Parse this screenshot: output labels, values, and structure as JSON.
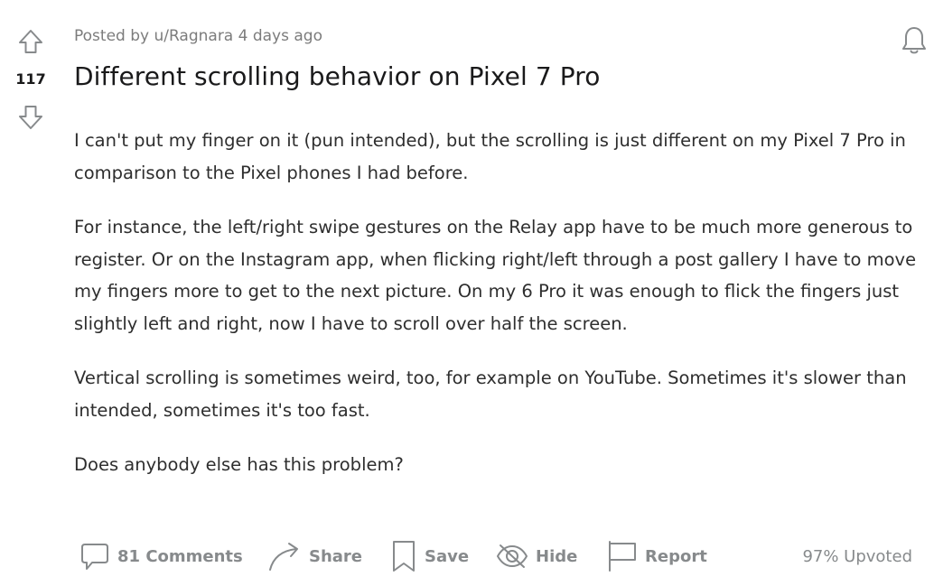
{
  "post": {
    "score": "117",
    "meta": "Posted by u/Ragnara 4 days ago",
    "title": "Different scrolling behavior on Pixel 7 Pro",
    "paragraphs": [
      "I can't put my finger on it (pun intended), but the scrolling is just different on my Pixel 7 Pro in comparison to the Pixel phones I had before.",
      "For instance, the left/right swipe gestures on the Relay app have to be much more generous to register. Or on the Instagram app, when flicking right/left through a post gallery I have to move my fingers more to get to the next picture. On my 6 Pro it was enough to flick the fingers just slightly left and right, now I have to scroll over half the screen.",
      "Vertical scrolling is sometimes weird, too, for example on YouTube. Sometimes it's slower than intended, sometimes it's too fast.",
      "Does anybody else has this problem?"
    ]
  },
  "actions": {
    "comments_label": "81 Comments",
    "share_label": "Share",
    "save_label": "Save",
    "hide_label": "Hide",
    "report_label": "Report",
    "upvoted_text": "97% Upvoted"
  },
  "icons": {
    "upvote": "upvote-arrow-icon",
    "downvote": "downvote-arrow-icon",
    "bell": "notification-bell-icon",
    "comments": "comment-bubble-icon",
    "share": "share-arrow-icon",
    "save": "bookmark-icon",
    "hide": "eye-slash-icon",
    "report": "flag-icon"
  },
  "colors": {
    "text": "#1a1a1b",
    "muted": "#878a8c",
    "meta": "#7c7c7c"
  }
}
